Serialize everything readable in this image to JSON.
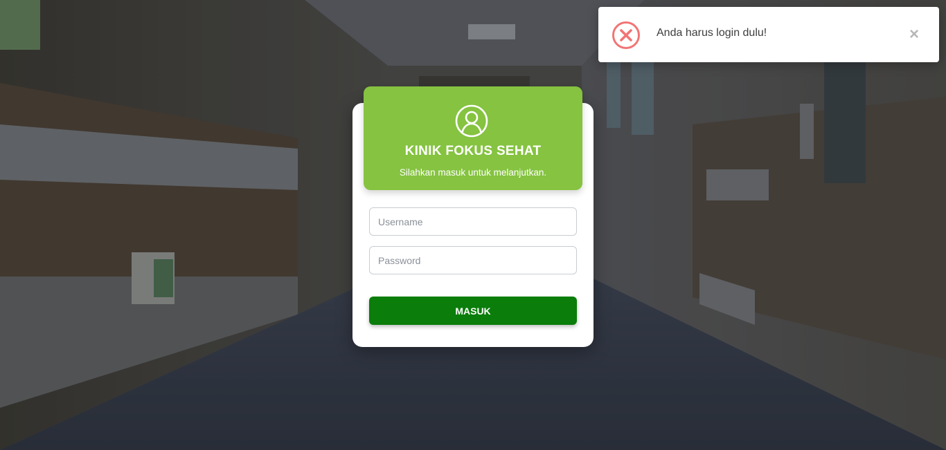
{
  "login": {
    "title": "KINIK FOKUS SEHAT",
    "subtitle": "Silahkan masuk untuk melanjutkan.",
    "username_placeholder": "Username",
    "username_value": "",
    "password_placeholder": "Password",
    "password_value": "",
    "submit_label": "MASUK",
    "icon": "user-circle-icon"
  },
  "toast": {
    "message": "Anda harus login dulu!",
    "close_label": "×",
    "icon": "error-circle-icon",
    "type": "error"
  },
  "colors": {
    "header_green": "#85c340",
    "button_green": "#0a7d0a",
    "error_red": "#f27474",
    "card_white": "#ffffff"
  }
}
